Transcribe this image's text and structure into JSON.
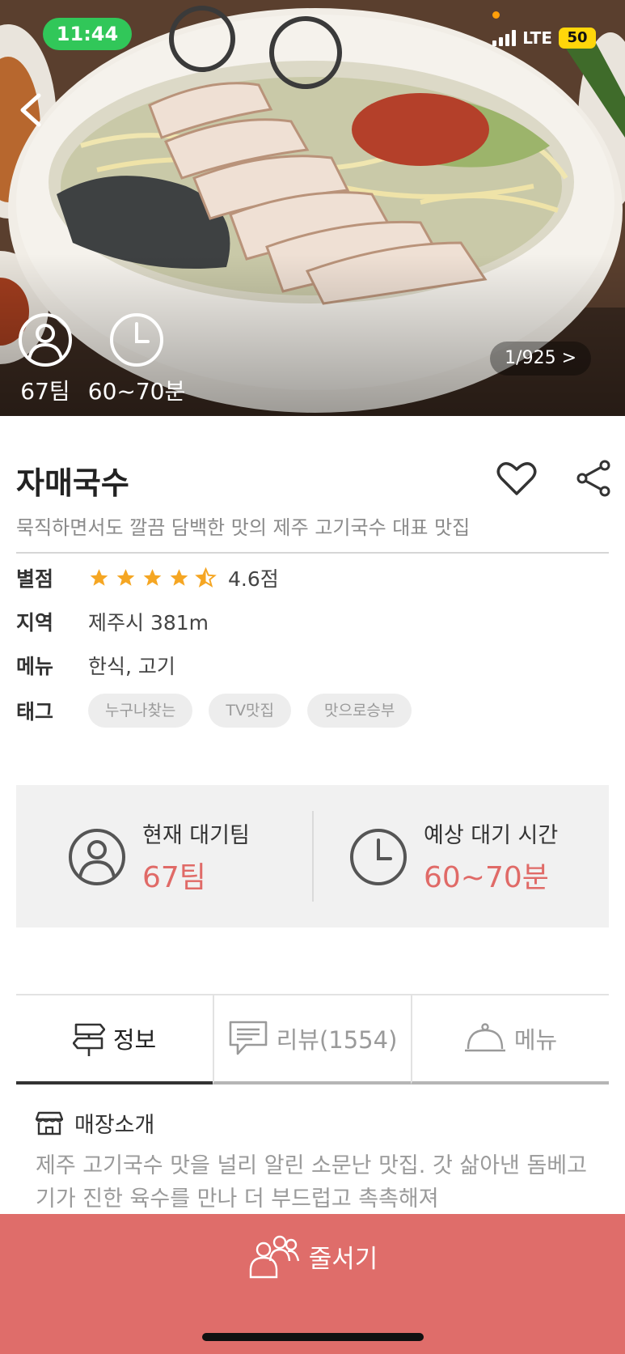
{
  "status_bar": {
    "time": "11:44",
    "network": "LTE",
    "battery": "50"
  },
  "hero": {
    "team_count": "67팀",
    "wait_time": "60~70분",
    "photo_counter": "1/925 >"
  },
  "restaurant": {
    "name": "자매국수",
    "description": "묵직하면서도 깔끔 담백한 맛의 제주 고기국수 대표 맛집"
  },
  "info": {
    "rating_label": "별점",
    "rating_value": "4.6점",
    "rating": 4.6,
    "region_label": "지역",
    "region_value": "제주시 381m",
    "menu_label": "메뉴",
    "menu_value": "한식, 고기",
    "tag_label": "태그",
    "tags": [
      "누구나찾는",
      "TV맛집",
      "맛으로승부"
    ]
  },
  "wait": {
    "team_label": "현재 대기팀",
    "team_value": "67팀",
    "time_label": "예상 대기 시간",
    "time_value": "60~70분"
  },
  "tabs": [
    {
      "label": "정보",
      "icon": "signpost-icon",
      "active": true
    },
    {
      "label": "리뷰(1554)",
      "icon": "chat-bubble-icon",
      "active": false
    },
    {
      "label": "메뉴",
      "icon": "cloche-icon",
      "active": false
    }
  ],
  "store_intro": {
    "heading": "매장소개",
    "text": "제주 고기국수 맛을 널리 알린 소문난 맛집. 갓 삶아낸 돔베고기가 진한 육수를 만나 더 부드럽고 촉촉해져"
  },
  "cta": {
    "label": "줄서기"
  },
  "colors": {
    "accent": "#df6d6a",
    "star": "#f5a623",
    "status_green": "#31c759"
  }
}
